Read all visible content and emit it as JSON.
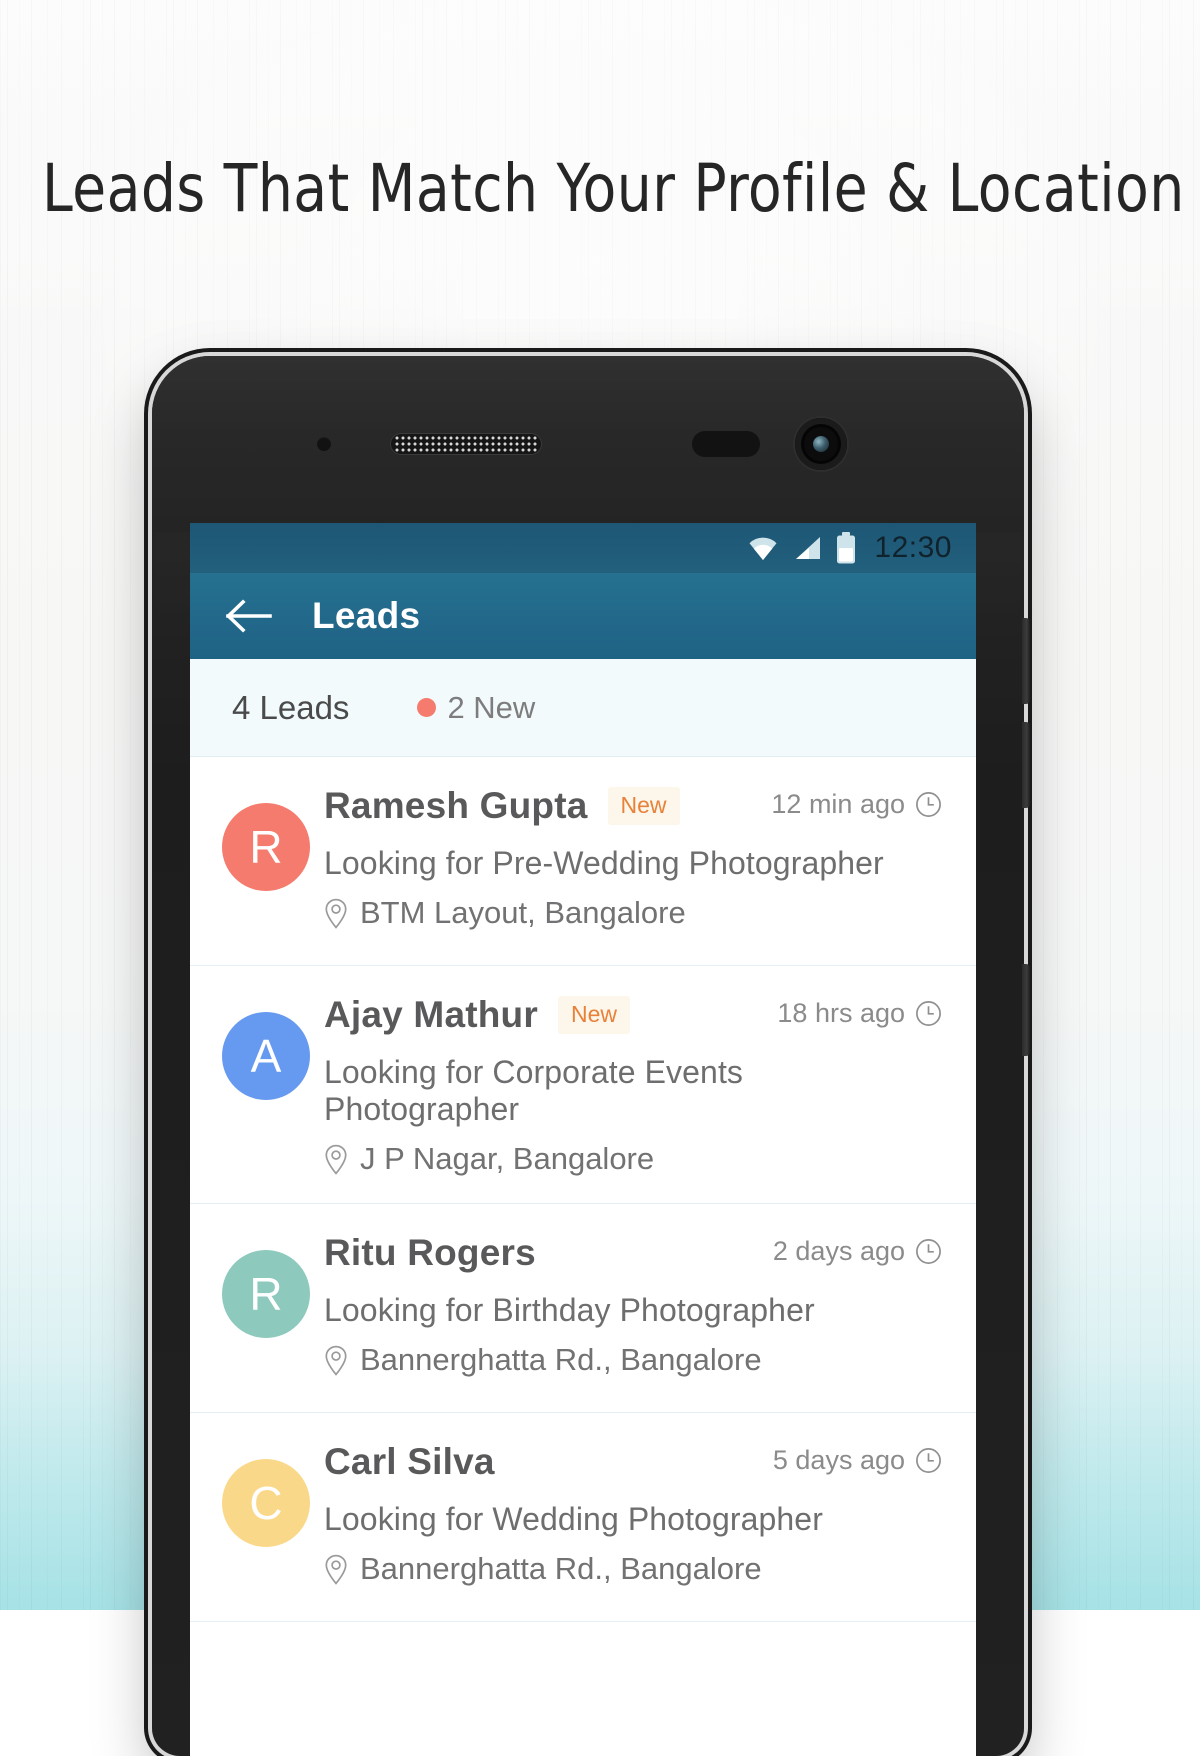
{
  "headline": "Leads That Match Your Profile & Location",
  "colors": {
    "statusbar": "#22607d",
    "appbar": "#22688a",
    "summary_bg": "#f2fafc",
    "new_dot": "#f47b6e",
    "badge_text": "#e8823a",
    "badge_bg": "#fdf6ea",
    "divider": "#e4f0f5"
  },
  "statusbar": {
    "time": "12:30",
    "icons": [
      "wifi-icon",
      "cellular-signal-icon",
      "battery-icon"
    ]
  },
  "appbar": {
    "back_icon": "back-arrow-icon",
    "title": "Leads"
  },
  "summary": {
    "count_label": "4 Leads",
    "new_label": "2 New"
  },
  "leads": [
    {
      "initial": "R",
      "avatar_color": "#f47b6e",
      "name": "Ramesh Gupta",
      "badge": "New",
      "time": "12 min ago",
      "description": "Looking for Pre-Wedding Photographer",
      "location": "BTM Layout, Bangalore"
    },
    {
      "initial": "A",
      "avatar_color": "#6699f0",
      "name": "Ajay Mathur",
      "badge": "New",
      "time": "18 hrs ago",
      "description": "Looking for Corporate Events Photographer",
      "location": "J P Nagar, Bangalore"
    },
    {
      "initial": "R",
      "avatar_color": "#8dc9bd",
      "name": "Ritu Rogers",
      "badge": "",
      "time": "2 days ago",
      "description": "Looking for Birthday Photographer",
      "location": "Bannerghatta Rd., Bangalore"
    },
    {
      "initial": "C",
      "avatar_color": "#fad889",
      "name": "Carl Silva",
      "badge": "",
      "time": "5 days ago",
      "description": "Looking for Wedding Photographer",
      "location": "Bannerghatta Rd., Bangalore"
    }
  ]
}
